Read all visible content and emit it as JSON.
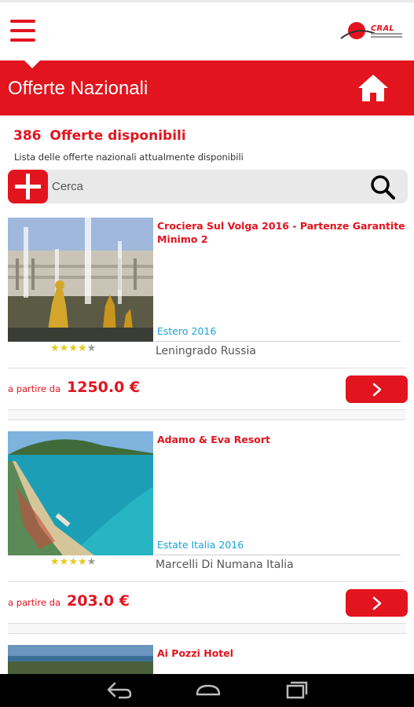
{
  "header": {
    "logo_text": "CRAL",
    "title": "Offerte Nazionali"
  },
  "offers_summary": {
    "count": "386",
    "label": "Offerte disponibili",
    "description": "Lista delle offerte nazionali attualmente disponibili"
  },
  "search": {
    "placeholder": "Cerca"
  },
  "offers": [
    {
      "title": "Crociera Sul Volga 2016 - Partenze Garantite Minimo 2",
      "category": "Estero 2016",
      "location": "Leningrado Russia",
      "rating": 4,
      "rating_max": 5,
      "price_prefix": "a partire da",
      "price": "1250.0 €"
    },
    {
      "title": "Adamo & Eva Resort",
      "category": "Estate Italia 2016",
      "location": "Marcelli Di Numana Italia",
      "rating": 4,
      "rating_max": 5,
      "price_prefix": "a partire da",
      "price": "203.0 €"
    },
    {
      "title": "Ai Pozzi Hotel"
    }
  ],
  "colors": {
    "accent": "#e2141e",
    "category": "#1aa3d6",
    "star": "#e6c91b"
  }
}
